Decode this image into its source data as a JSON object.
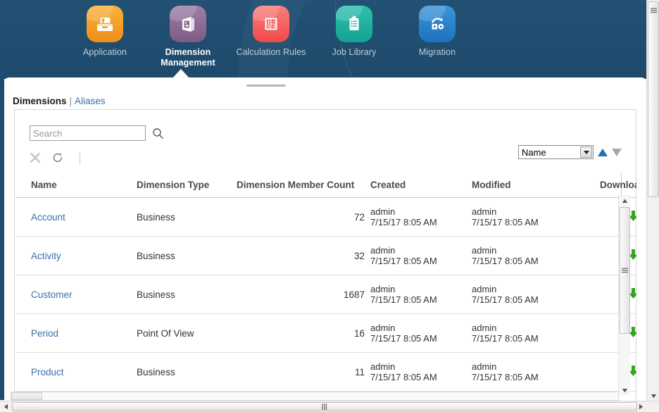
{
  "theme": {
    "header_bg": "#1f4d70",
    "link_color": "#3b6ea8",
    "accent_blue": "#1a73b8",
    "download_green": "#36a420"
  },
  "nav": {
    "items": [
      {
        "label": "Application",
        "icon": "application-icon",
        "color_from": "#f9b23c",
        "color_to": "#ef8e1b",
        "active": false
      },
      {
        "label": "Dimension Management",
        "icon": "dimension-management-icon",
        "color_from": "#9e7fa6",
        "color_to": "#7d5b86",
        "active": true
      },
      {
        "label": "Calculation Rules",
        "icon": "calculation-rules-icon",
        "color_from": "#fa7d7d",
        "color_to": "#f04a4a",
        "active": false
      },
      {
        "label": "Job Library",
        "icon": "job-library-icon",
        "color_from": "#2fc0ad",
        "color_to": "#14a294",
        "active": false
      },
      {
        "label": "Migration",
        "icon": "migration-icon",
        "color_from": "#3a95d8",
        "color_to": "#1f72bd",
        "active": false
      }
    ]
  },
  "breadcrumb": {
    "active": "Dimensions",
    "separator": "|",
    "link": "Aliases"
  },
  "toolbar": {
    "search_placeholder": "Search",
    "search_value": "",
    "search_icon": "magnifier-icon",
    "clear_icon": "close-x-icon",
    "refresh_icon": "refresh-icon",
    "sort_label": "Name",
    "sort_options": [
      "Name"
    ],
    "sort_asc_icon": "triangle-up-icon",
    "sort_desc_icon": "triangle-down-icon"
  },
  "table": {
    "columns": [
      "Name",
      "Dimension Type",
      "Dimension Member Count",
      "Created",
      "Modified",
      "Download"
    ],
    "rows": [
      {
        "name": "Account",
        "type": "Business",
        "count": "72",
        "created_user": "admin",
        "created_time": "7/15/17 8:05 AM",
        "modified_user": "admin",
        "modified_time": "7/15/17 8:05 AM",
        "download_icon": "download-arrow-icon"
      },
      {
        "name": "Activity",
        "type": "Business",
        "count": "32",
        "created_user": "admin",
        "created_time": "7/15/17 8:05 AM",
        "modified_user": "admin",
        "modified_time": "7/15/17 8:05 AM",
        "download_icon": "download-arrow-icon"
      },
      {
        "name": "Customer",
        "type": "Business",
        "count": "1687",
        "created_user": "admin",
        "created_time": "7/15/17 8:05 AM",
        "modified_user": "admin",
        "modified_time": "7/15/17 8:05 AM",
        "download_icon": "download-arrow-icon"
      },
      {
        "name": "Period",
        "type": "Point Of View",
        "count": "16",
        "created_user": "admin",
        "created_time": "7/15/17 8:05 AM",
        "modified_user": "admin",
        "modified_time": "7/15/17 8:05 AM",
        "download_icon": "download-arrow-icon"
      },
      {
        "name": "Product",
        "type": "Business",
        "count": "11",
        "created_user": "admin",
        "created_time": "7/15/17 8:05 AM",
        "modified_user": "admin",
        "modified_time": "7/15/17 8:05 AM",
        "download_icon": "download-arrow-icon"
      }
    ]
  },
  "scrollbars": {
    "table_vertical": {
      "up_icon": "scroll-up-icon",
      "down_icon": "scroll-down-icon"
    },
    "page_horizontal": {
      "left_icon": "scroll-left-icon",
      "right_icon": "scroll-right-icon"
    }
  }
}
